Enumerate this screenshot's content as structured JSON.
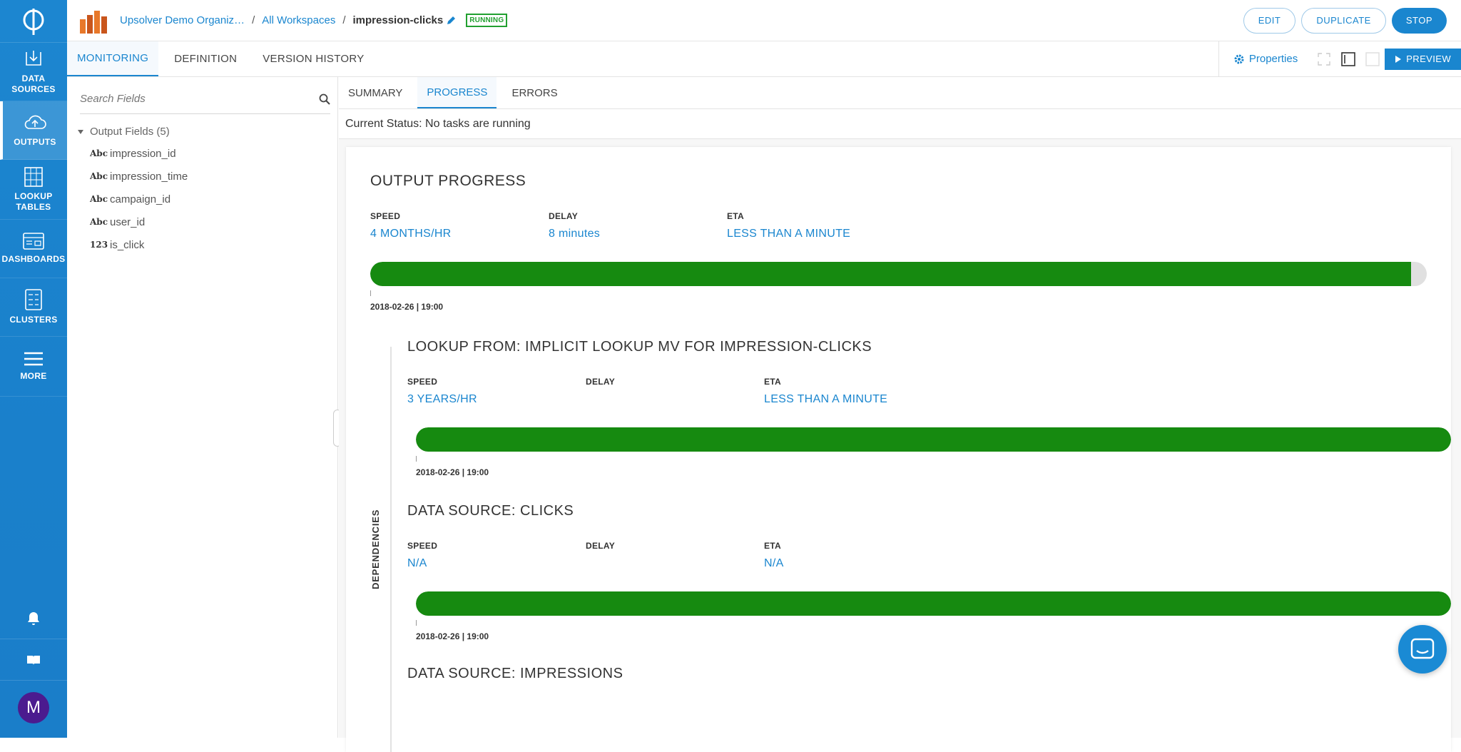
{
  "nav": {
    "items": [
      {
        "label_line1": "DATA",
        "label_line2": "SOURCES"
      },
      {
        "label_line1": "OUTPUTS",
        "label_line2": ""
      },
      {
        "label_line1": "LOOKUP",
        "label_line2": "TABLES"
      },
      {
        "label_line1": "DASHBOARDS",
        "label_line2": ""
      },
      {
        "label_line1": "CLUSTERS",
        "label_line2": ""
      },
      {
        "label_line1": "MORE",
        "label_line2": ""
      }
    ],
    "avatar_letter": "M"
  },
  "breadcrumb": {
    "org": "Upsolver Demo Organiz…",
    "workspaces": "All Workspaces",
    "current": "impression-clicks",
    "status": "RUNNING"
  },
  "actions": {
    "edit": "EDIT",
    "duplicate": "DUPLICATE",
    "stop": "STOP"
  },
  "tabs": [
    "MONITORING",
    "DEFINITION",
    "VERSION HISTORY"
  ],
  "properties_label": "Properties",
  "preview_label": "PREVIEW",
  "fields_panel": {
    "search_placeholder": "Search Fields",
    "group_label": "Output Fields (5)",
    "fields": [
      {
        "type": "Abc",
        "name": "impression_id"
      },
      {
        "type": "Abc",
        "name": "impression_time"
      },
      {
        "type": "Abc",
        "name": "campaign_id"
      },
      {
        "type": "Abc",
        "name": "user_id"
      },
      {
        "type": "123",
        "name": "is_click"
      }
    ]
  },
  "subtabs": [
    "SUMMARY",
    "PROGRESS",
    "ERRORS"
  ],
  "current_status": "Current Status: No tasks are running",
  "output_progress": {
    "title": "OUTPUT PROGRESS",
    "speed_label": "SPEED",
    "speed": "4 MONTHS/HR",
    "delay_label": "DELAY",
    "delay": "8  minutes",
    "eta_label": "ETA",
    "eta": "LESS THAN A MINUTE",
    "progress": 0.985,
    "timestamp": "2018-02-26 | 19:00"
  },
  "dependencies_label": "DEPENDENCIES",
  "dependencies": [
    {
      "title": "LOOKUP FROM: IMPLICIT LOOKUP MV FOR IMPRESSION-CLICKS",
      "speed_label": "SPEED",
      "speed": "3 YEARS/HR",
      "delay_label": "DELAY",
      "delay": "",
      "eta_label": "ETA",
      "eta": "LESS THAN A MINUTE",
      "progress": 1.0,
      "timestamp": "2018-02-26 | 19:00"
    },
    {
      "title": "DATA SOURCE: CLICKS",
      "speed_label": "SPEED",
      "speed": "N/A",
      "delay_label": "DELAY",
      "delay": "",
      "eta_label": "ETA",
      "eta": "N/A",
      "progress": 1.0,
      "timestamp": "2018-02-26 | 19:00"
    },
    {
      "title": "DATA SOURCE: IMPRESSIONS"
    }
  ],
  "colors": {
    "accent": "#1a86cf",
    "progress": "#168a10",
    "nav": "#1c86d0",
    "running": "#22a030"
  }
}
